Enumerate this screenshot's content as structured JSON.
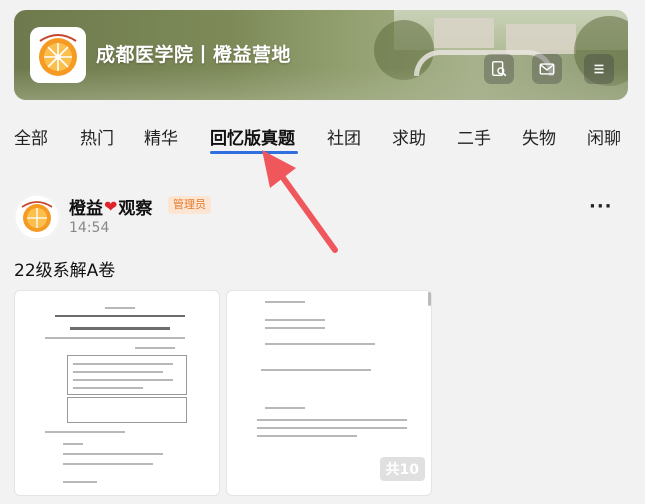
{
  "header": {
    "title": "成都医学院丨橙益营地",
    "logo_text": "成都医学院",
    "buttons": [
      "search-doc-icon",
      "mail-icon",
      "menu-icon"
    ]
  },
  "tabs": [
    {
      "label": "全部"
    },
    {
      "label": "热门"
    },
    {
      "label": "精华"
    },
    {
      "label": "回忆版真题",
      "active": true
    },
    {
      "label": "社团"
    },
    {
      "label": "求助"
    },
    {
      "label": "二手"
    },
    {
      "label": "失物"
    },
    {
      "label": "闲聊"
    }
  ],
  "post": {
    "author_prefix": "橙益",
    "author_suffix": "观察",
    "badge": "管理员",
    "time": "14:54",
    "text": "22级系解A卷",
    "more": "···",
    "image_count": "共10"
  },
  "colors": {
    "accent": "#2f6fe0",
    "arrow": "#f0575c",
    "badge_bg": "#fde5d3",
    "badge_fg": "#e57a2a"
  }
}
